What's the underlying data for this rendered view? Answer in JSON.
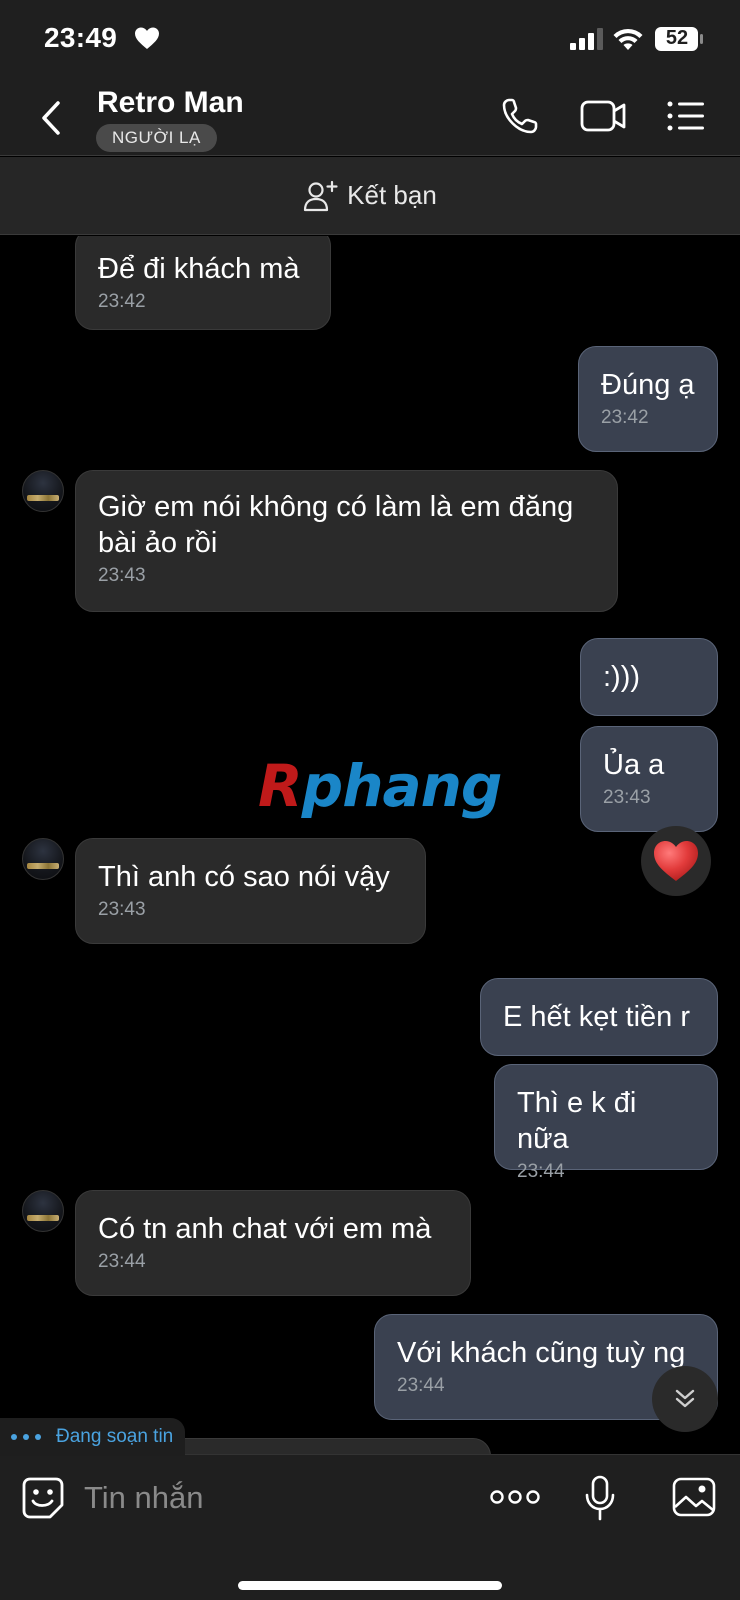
{
  "status_bar": {
    "time": "23:49",
    "battery": "52"
  },
  "header": {
    "contact_name": "Retro Man",
    "badge": "NGƯỜI LẠ"
  },
  "add_friend": {
    "label": "Kết bạn"
  },
  "messages": [
    {
      "dir": "in",
      "text": "Để đi khách mà",
      "time": "23:42"
    },
    {
      "dir": "out",
      "text": "Đúng ạ",
      "time": "23:42"
    },
    {
      "dir": "in",
      "text": "Giờ em nói không có làm là em đăng bài ảo rồi",
      "time": "23:43"
    },
    {
      "dir": "out",
      "text": ":)))",
      "time": ""
    },
    {
      "dir": "out",
      "text": "Ủa a",
      "time": "23:43",
      "reaction": "heart"
    },
    {
      "dir": "in",
      "text": "Thì anh có sao nói vậy",
      "time": "23:43"
    },
    {
      "dir": "out",
      "text": "E hết kẹt tiền r",
      "time": ""
    },
    {
      "dir": "out",
      "text": "Thì e k đi nữa",
      "time": "23:44"
    },
    {
      "dir": "in",
      "text": "Có tn anh chat với em mà",
      "time": "23:44"
    },
    {
      "dir": "out",
      "text": "Với khách cũng tuỳ ng",
      "time": "23:44"
    }
  ],
  "watermark": {
    "first": "R",
    "rest": "phang"
  },
  "typing_indicator": "Đang soạn tin",
  "composer": {
    "placeholder": "Tin nhắn"
  },
  "colors": {
    "accent": "#4aa3e0",
    "bubble_out": "#3a4150",
    "bubble_in": "#2a2a2a",
    "reaction_heart": "#e23b3b"
  }
}
